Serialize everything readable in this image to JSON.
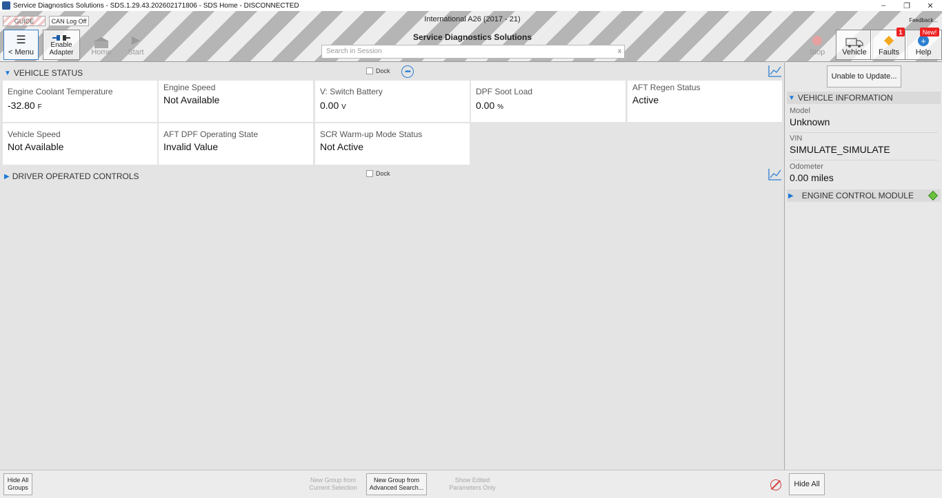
{
  "window": {
    "title": "Service Diagnostics Solutions - SDS.1.29.43.202602171806 - SDS Home - DISCONNECTED",
    "minimize": "–",
    "maximize": "❐",
    "close": "✕"
  },
  "toolbar": {
    "guide_label": "GUIDE",
    "can_log_label": "CAN Log Off",
    "menu_label": "< Menu",
    "enable_adapter_line1": "Enable",
    "enable_adapter_line2": "Adapter",
    "home_label": "Home",
    "start_label": "Start",
    "vehicle_header": "International A26 (2017 - 21)",
    "app_title": "Service Diagnostics Solutions",
    "search_placeholder": "Search in Session",
    "search_clear": "x",
    "feedback_label": "Feedback...",
    "stop_label": "Stop",
    "vehicle_label": "Vehicle",
    "faults_label": "Faults",
    "faults_badge": "1",
    "help_label": "Help",
    "help_badge": "New!"
  },
  "vehicle_status": {
    "title": "VEHICLE STATUS",
    "dock_label": "Dock",
    "tiles": [
      {
        "label": "Engine Coolant Temperature",
        "value": "-32.80",
        "unit": "F"
      },
      {
        "label": "Engine Speed",
        "value": "Not Available",
        "unit": ""
      },
      {
        "label": "V: Switch Battery",
        "value": "0.00",
        "unit": "V"
      },
      {
        "label": "DPF Soot Load",
        "value": "0.00",
        "unit": "%"
      },
      {
        "label": "AFT Regen Status",
        "value": "Active",
        "unit": ""
      },
      {
        "label": "Vehicle Speed",
        "value": "Not Available",
        "unit": ""
      },
      {
        "label": "AFT DPF Operating State",
        "value": "Invalid Value",
        "unit": ""
      },
      {
        "label": "SCR Warm-up Mode Status",
        "value": "Not Active",
        "unit": ""
      }
    ]
  },
  "driver_controls": {
    "title": "DRIVER OPERATED CONTROLS",
    "dock_label": "Dock"
  },
  "right_panel": {
    "update_label": "Unable to Update...",
    "vehicle_info_title": "VEHICLE INFORMATION",
    "fields": [
      {
        "label": "Model",
        "value": "Unknown"
      },
      {
        "label": "VIN",
        "value": "SIMULATE_SIMULATE"
      },
      {
        "label": "Odometer",
        "value": "0.00 miles"
      }
    ],
    "ecm_title": "ENGINE CONTROL MODULE"
  },
  "bottombar": {
    "hide_all_groups_1": "Hide All",
    "hide_all_groups_2": "Groups",
    "new_group_sel_1": "New Group from",
    "new_group_sel_2": "Current Selection",
    "new_group_adv_1": "New Group from",
    "new_group_adv_2": "Advanced Search...",
    "show_edited_1": "Show Edited",
    "show_edited_2": "Parameters Only",
    "hide_all": "Hide All"
  },
  "colors": {
    "accent": "#1a7ad8",
    "badge_red": "#e22222",
    "ecm_status": "#6ac23c"
  }
}
